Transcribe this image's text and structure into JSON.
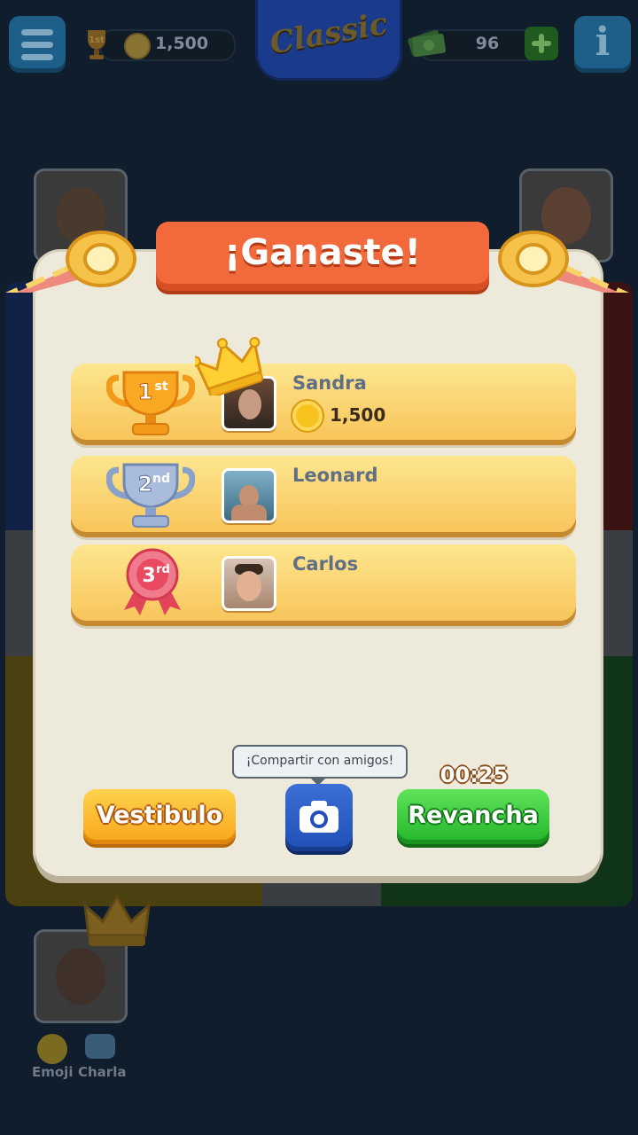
{
  "header": {
    "rank_badge": "1st",
    "coins": "1,500",
    "mode_title": "Classic",
    "cash": "96"
  },
  "dialog": {
    "title": "¡Ganaste!",
    "results": [
      {
        "rank": "1",
        "suffix": "st",
        "name": "Sandra",
        "prize": "1,500"
      },
      {
        "rank": "2",
        "suffix": "nd",
        "name": "Leonard",
        "prize": ""
      },
      {
        "rank": "3",
        "suffix": "rd",
        "name": "Carlos",
        "prize": ""
      }
    ],
    "share_tooltip": "¡Compartir con amigos!",
    "timer": "00:25",
    "lobby_label": "Vestibulo",
    "rematch_label": "Revancha"
  },
  "bottom_bar": {
    "emoji_label": "Emoji",
    "chat_label": "Charla"
  },
  "colors": {
    "banner": "#f26a3b",
    "row": "#f8c55a",
    "rematch": "#23b52a",
    "lobby": "#f7a51b",
    "camera": "#1f4fb7"
  },
  "icons": [
    "menu-icon",
    "trophy-icon",
    "coin-icon",
    "cash-icon",
    "plus-icon",
    "info-icon",
    "crown-icon",
    "camera-icon",
    "emoji-icon",
    "chat-icon",
    "party-horn-icon",
    "ribbon-icon"
  ]
}
